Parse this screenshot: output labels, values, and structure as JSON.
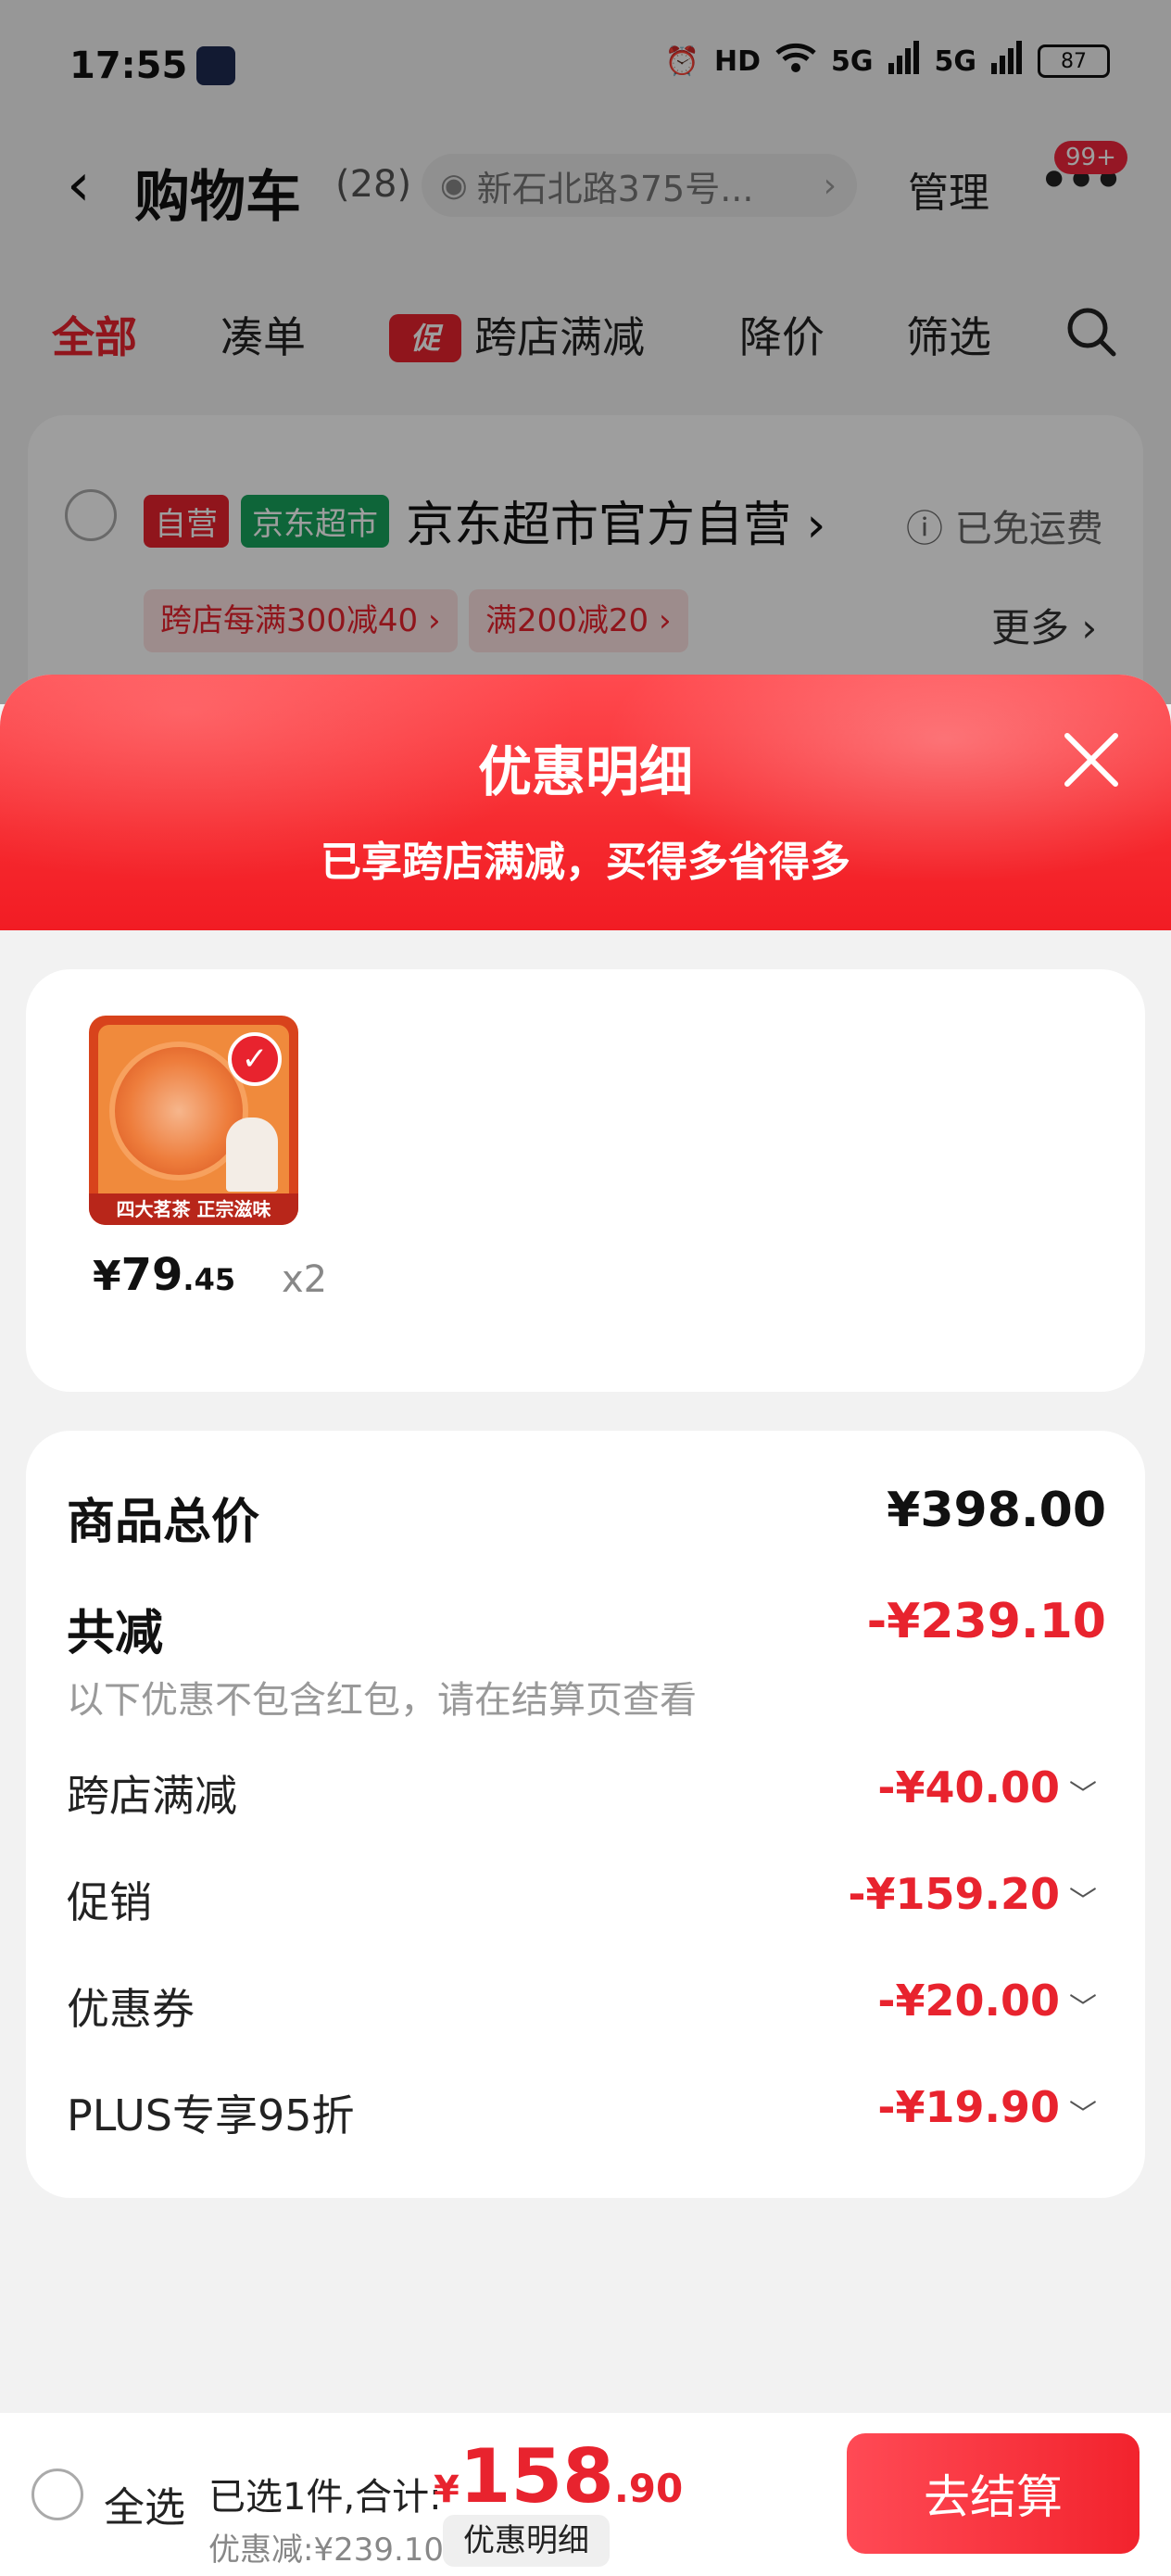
{
  "status_bar": {
    "time": "17:55",
    "hd_label": "HD",
    "network_1": "5G",
    "network_2": "5G",
    "battery": "87"
  },
  "nav": {
    "back_icon": "chevron-left-icon",
    "title": "购物车",
    "count": "(28)",
    "address": "新石北路375号...",
    "manage": "管理",
    "badge": "99+"
  },
  "tabs": [
    {
      "label": "全部",
      "active": true
    },
    {
      "label": "凑单"
    },
    {
      "label": "跨店满减",
      "tag": "促"
    },
    {
      "label": "降价"
    },
    {
      "label": "筛选"
    }
  ],
  "store": {
    "tag_self": "自营",
    "tag_super": "京东超市",
    "name": "京东超市官方自营",
    "shipping": "已免运费",
    "promo_1": "跨店每满300减40",
    "promo_2": "满200减20",
    "more": "更多"
  },
  "sheet": {
    "title": "优惠明细",
    "subtitle": "已享跨店满减，买得多省得多",
    "close_icon": "close-icon"
  },
  "product": {
    "currency": "¥",
    "price_int": "79",
    "price_dec": ".45",
    "qty": "x2",
    "thumb_banner": "四大茗茶  正宗滋味"
  },
  "details": {
    "total_label": "商品总价",
    "total_value": "¥398.00",
    "reduce_label": "共减",
    "reduce_value": "-¥239.10",
    "note": "以下优惠不包含红包，请在结算页查看",
    "rows": [
      {
        "label": "跨店满减",
        "value": "-¥40.00"
      },
      {
        "label": "促销",
        "value": "-¥159.20"
      },
      {
        "label": "优惠券",
        "value": "-¥20.00"
      },
      {
        "label": "PLUS专享95折",
        "value": "-¥19.90"
      }
    ]
  },
  "bottom": {
    "select_all": "全选",
    "selected_text": "已选1件,合计:",
    "currency": "¥",
    "total_int": "158",
    "total_dec": ".90",
    "discount": "优惠减:¥239.10",
    "detail_chip": "优惠明细",
    "checkout": "去结算"
  },
  "colors": {
    "accent": "#e8232e",
    "green_tag": "#17a35c"
  }
}
